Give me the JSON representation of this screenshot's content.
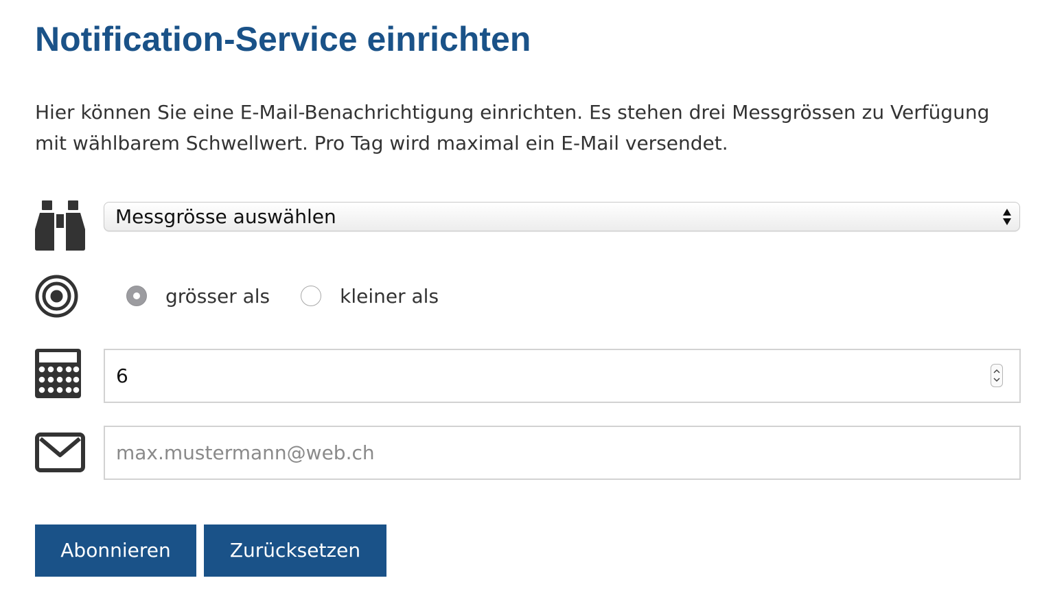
{
  "page": {
    "title": "Notification-Service einrichten",
    "intro": "Hier können Sie eine E-Mail-Benachrichtigung einrichten. Es stehen drei Messgrössen zu Verfügung mit wählbarem Schwellwert. Pro Tag wird maximal ein E-Mail versendet."
  },
  "form": {
    "measure_select": {
      "icon": "binoculars-icon",
      "selected": "Messgrösse auswählen"
    },
    "comparison": {
      "icon": "target-icon",
      "options": [
        {
          "label": "grösser als",
          "checked": true
        },
        {
          "label": "kleiner als",
          "checked": false
        }
      ]
    },
    "threshold": {
      "icon": "calculator-icon",
      "value": "6"
    },
    "email": {
      "icon": "envelope-icon",
      "value": "",
      "placeholder": "max.mustermann@web.ch"
    }
  },
  "actions": {
    "subscribe_label": "Abonnieren",
    "reset_label": "Zurücksetzen"
  },
  "colors": {
    "accent": "#1a5288",
    "icon": "#333333",
    "text": "#333333"
  }
}
